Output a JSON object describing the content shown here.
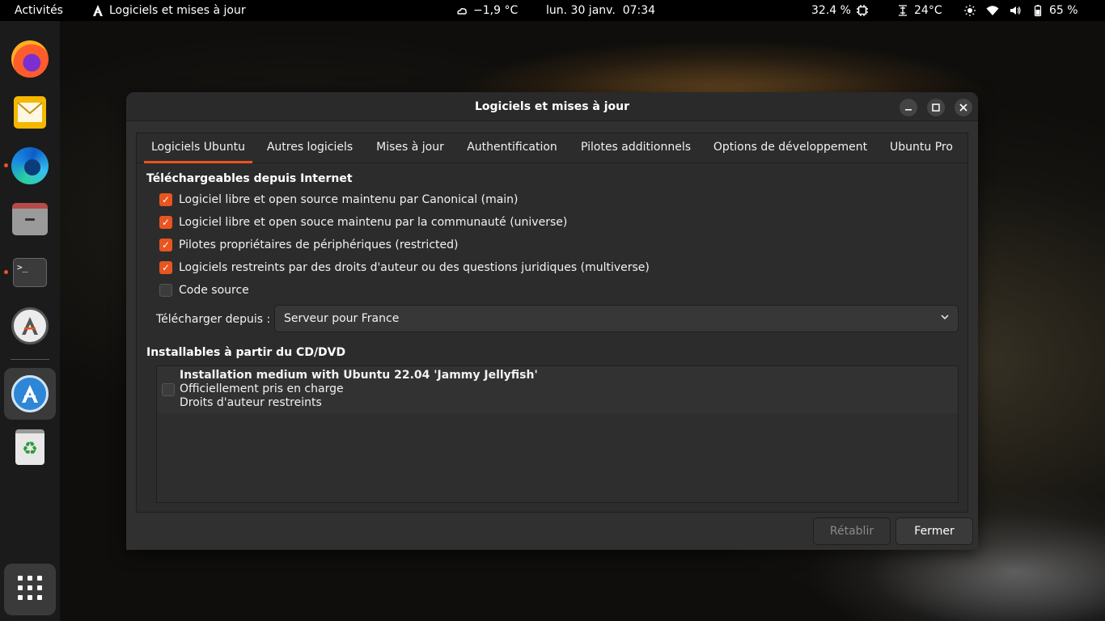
{
  "topbar": {
    "activities": "Activités",
    "app_name": "Logiciels et mises à jour",
    "weather": "−1,9 °C",
    "clock": "lun. 30 janv.  07:34",
    "cpu": "32.4 %",
    "temperature": "24°C",
    "battery": "65 %"
  },
  "dock": {
    "items": [
      "firefox-icon",
      "mail-icon",
      "edge-icon",
      "files-icon",
      "terminal-icon",
      "software-updater-icon",
      "software-properties-icon",
      "trash-icon",
      "apps-grid-icon"
    ]
  },
  "window": {
    "title": "Logiciels et mises à jour",
    "tabs": [
      "Logiciels Ubuntu",
      "Autres logiciels",
      "Mises à jour",
      "Authentification",
      "Pilotes additionnels",
      "Options de développement",
      "Ubuntu Pro"
    ],
    "internet_section": {
      "title": "Téléchargeables depuis Internet",
      "options": [
        {
          "label": "Logiciel libre et open source maintenu par Canonical (main)",
          "checked": true
        },
        {
          "label": "Logiciel libre et open souce maintenu par la communauté (universe)",
          "checked": true
        },
        {
          "label": "Pilotes propriétaires de périphériques (restricted)",
          "checked": true
        },
        {
          "label": "Logiciels restreints par des droits d'auteur ou des questions juridiques (multiverse)",
          "checked": true
        },
        {
          "label": "Code source",
          "checked": false
        }
      ],
      "download_from_label": "Télécharger depuis :",
      "download_from_value": "Serveur pour France"
    },
    "cd_section": {
      "title": "Installables à partir du CD/DVD",
      "entry_title": "Installation medium with Ubuntu 22.04 'Jammy Jellyfish'",
      "entry_line2": "Officiellement pris en charge",
      "entry_line3": "Droits d'auteur restreints",
      "checked": false
    },
    "buttons": {
      "revert": "Rétablir",
      "close": "Fermer"
    }
  },
  "colors": {
    "accent": "#e95420",
    "window_bg": "#303030",
    "topbar_bg": "#000000",
    "dock_bg": "#1b1b1b"
  }
}
